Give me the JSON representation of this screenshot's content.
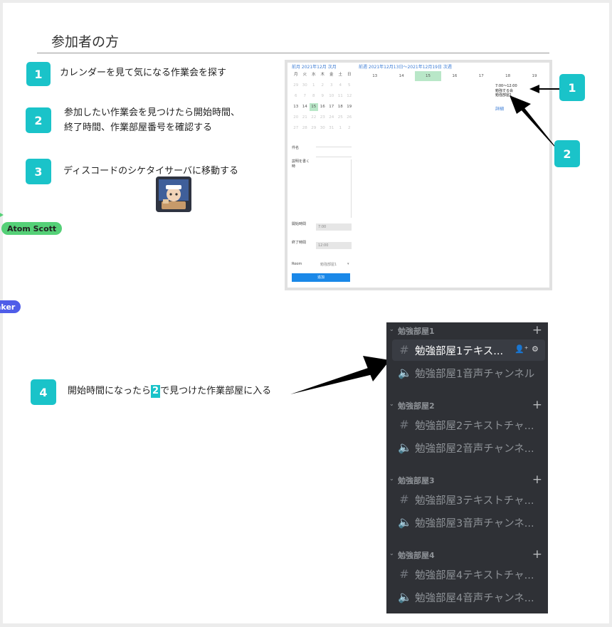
{
  "page": {
    "section_title": "参加者の方"
  },
  "steps": [
    {
      "number": "1",
      "text": "カレンダーを見て気になる作業会を探す"
    },
    {
      "number": "2",
      "text_line1": "参加したい作業会を見つけたら開始時間、",
      "text_line2": "終了時間、作業部屋番号を確認する"
    },
    {
      "number": "3",
      "text": "ディスコードのシケタイサーバに移動する"
    },
    {
      "number": "4",
      "text_before": "開始時間になったら",
      "text_badge": "2",
      "text_after": "で見つけた作業部屋に入る"
    }
  ],
  "callouts": {
    "one": "1",
    "two": "2"
  },
  "cursors": {
    "atom": "Atom Scott",
    "other": "aker"
  },
  "colors": {
    "badge": "#1ac3c9",
    "discord_bg": "#2f3136",
    "atom_cursor": "#55d077",
    "other_cursor": "#4f5de8",
    "calendar_highlight": "#b9e7c8"
  },
  "calendar": {
    "link_left": "前月 2021年12月 次月",
    "link_right": "前週 2021年12月13日〜2021年12月19日 次週",
    "weekday_headers": [
      "月",
      "火",
      "水",
      "木",
      "金",
      "土",
      "日"
    ],
    "mini_days": [
      [
        "29",
        "30",
        "1",
        "2",
        "3",
        "4",
        "5"
      ],
      [
        "6",
        "7",
        "8",
        "9",
        "10",
        "11",
        "12"
      ],
      [
        "13",
        "14",
        "15",
        "16",
        "17",
        "18",
        "19"
      ],
      [
        "20",
        "21",
        "22",
        "23",
        "24",
        "25",
        "26"
      ],
      [
        "27",
        "28",
        "29",
        "30",
        "31",
        "1",
        "2"
      ]
    ],
    "week_days": [
      "13",
      "14",
      "15",
      "16",
      "17",
      "18",
      "19"
    ],
    "event_text": "7:00～12:00\n勉強する会\n勉強部屋1",
    "event_link": "詳細",
    "form": {
      "label_title": "件名",
      "label_desc": "説明を書く時",
      "label_start": "開始時間",
      "value_start": "7:00",
      "label_end": "終了時間",
      "value_end": "12:00",
      "label_room": "Room",
      "value_room": "勉強部屋1",
      "submit": "追加"
    }
  },
  "discord": {
    "categories": [
      {
        "name": "勉強部屋1",
        "text_channel": "勉強部屋1テキス...",
        "voice_channel": "勉強部屋1音声チャンネル"
      },
      {
        "name": "勉強部屋2",
        "text_channel": "勉強部屋2テキストチャ...",
        "voice_channel": "勉強部屋2音声チャンネ..."
      },
      {
        "name": "勉強部屋3",
        "text_channel": "勉強部屋3テキストチャ...",
        "voice_channel": "勉強部屋3音声チャンネ..."
      },
      {
        "name": "勉強部屋4",
        "text_channel": "勉強部屋4テキストチャ...",
        "voice_channel": "勉強部屋4音声チャンネ..."
      }
    ]
  }
}
